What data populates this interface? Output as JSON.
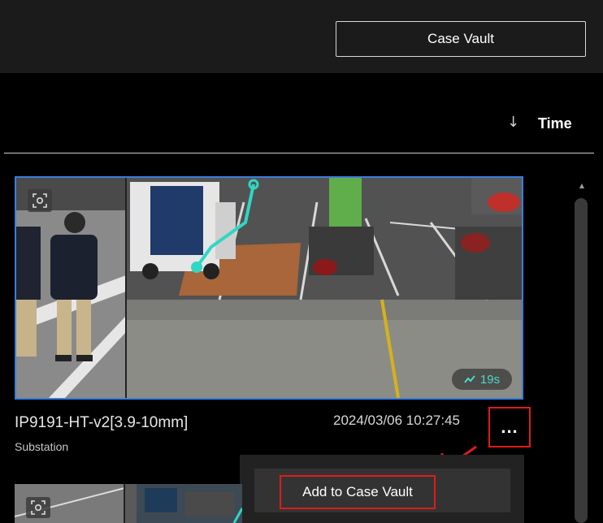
{
  "header": {
    "case_vault_button": "Case Vault"
  },
  "sort": {
    "direction_icon": "arrow-down-icon",
    "label": "Time"
  },
  "results": [
    {
      "camera_name": "IP9191-HT-v2[3.9-10mm]",
      "location": "Substation",
      "timestamp": "2024/03/06 10:27:45",
      "duration": "19s",
      "more_label": "...",
      "selected": true
    }
  ],
  "context_menu": {
    "items": [
      {
        "label": "Add to Case Vault"
      }
    ]
  },
  "colors": {
    "accent_border": "#3b7ddd",
    "annotation_red": "#e01b1b",
    "trajectory": "#2fd7c4"
  }
}
